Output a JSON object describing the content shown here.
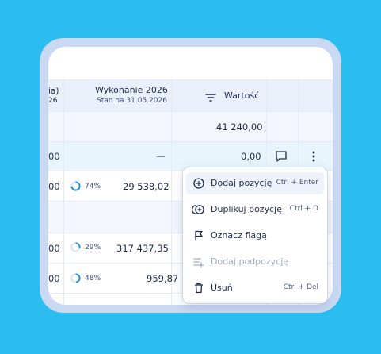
{
  "table": {
    "header_left_line1": "ia)",
    "header_left_line2": "26",
    "header_wykonanie_title": "Wykonanie 2026",
    "header_wykonanie_sub": "Stan na 31.05.2026",
    "header_wartosc": "Wartość",
    "row1_wartosc": "41 240,00",
    "row2_left": "00",
    "row2_dash": "—",
    "row2_wartosc": "0,00",
    "row3_left": "00",
    "row3_pct": "74%",
    "row3_value": "29 538,02",
    "row5_left": "00",
    "row5_pct": "29%",
    "row5_value": "317 437,35",
    "row6_left": "00",
    "row6_pct": "48%",
    "row6_value": "959,87",
    "progress": {
      "row3": 0.74,
      "row5": 0.29,
      "row6": 0.48
    }
  },
  "menu": {
    "items": [
      {
        "label": "Dodaj pozycję",
        "shortcut": "Ctrl + Enter",
        "icon": "plus-circle-icon"
      },
      {
        "label": "Duplikuj pozycję",
        "shortcut": "Ctrl + D",
        "icon": "duplicate-icon"
      },
      {
        "label": "Oznacz flagą",
        "shortcut": "",
        "icon": "flag-icon"
      },
      {
        "label": "Dodaj podpozycję",
        "shortcut": "",
        "icon": "add-subitem-icon"
      },
      {
        "label": "Usuń",
        "shortcut": "Ctrl + Del",
        "icon": "trash-icon"
      }
    ]
  },
  "colors": {
    "background": "#2bbcf0",
    "accent": "#1a8fd6",
    "header_bg": "#eaf0fa",
    "selected_row": "#e8f5fc"
  }
}
